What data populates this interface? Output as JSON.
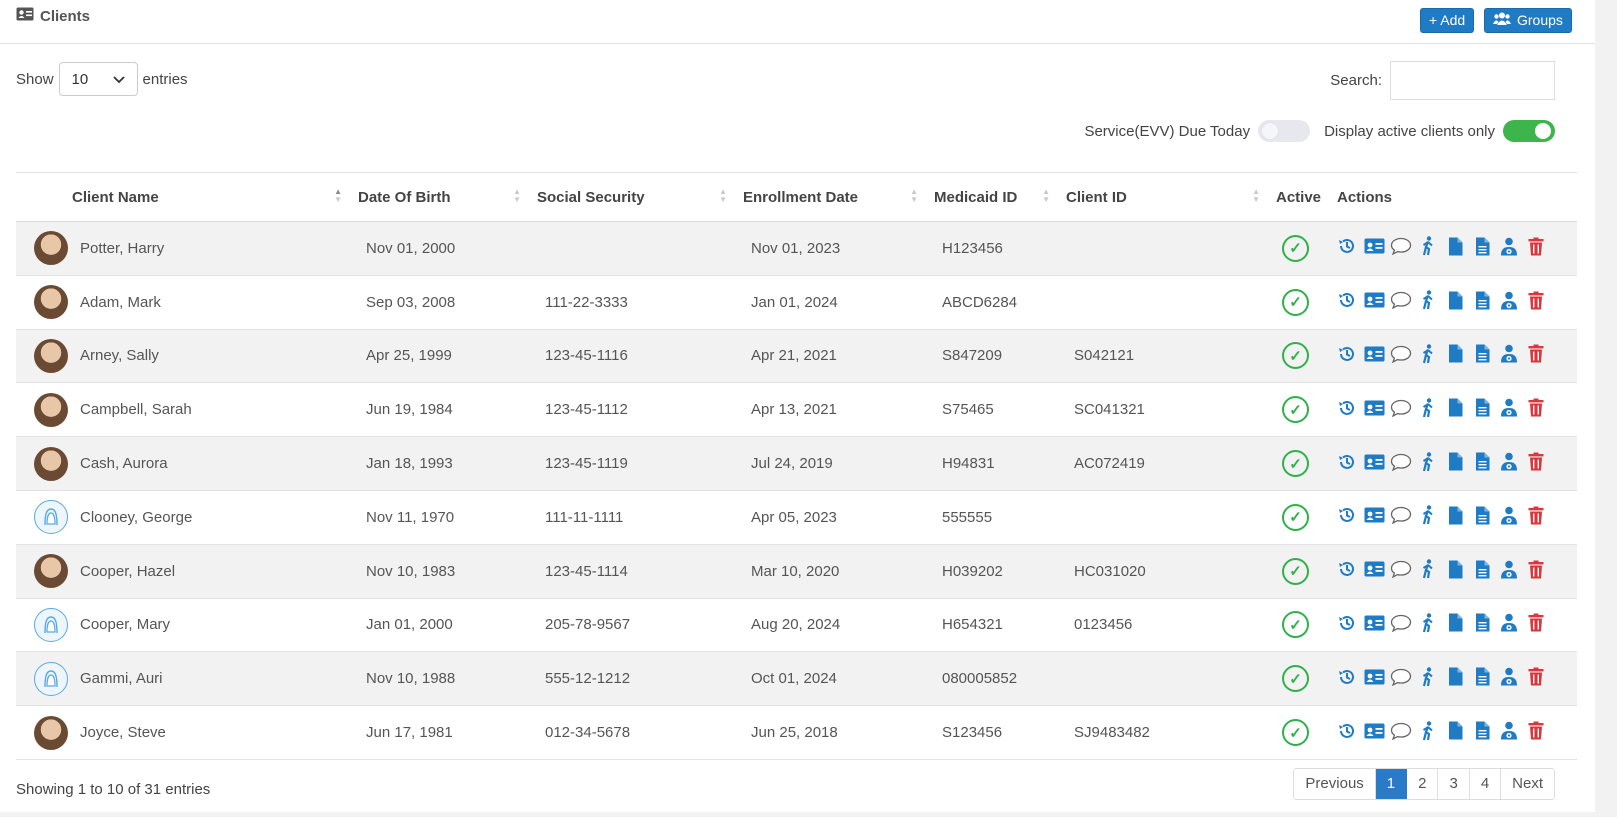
{
  "header": {
    "title": "Clients",
    "add_label": "+ Add",
    "groups_label": "Groups"
  },
  "length": {
    "show_label": "Show",
    "selected": "10",
    "entries_label": "entries"
  },
  "search": {
    "label": "Search:",
    "value": ""
  },
  "toggles": {
    "evv_label": "Service(EVV) Due Today",
    "evv_on": false,
    "active_label": "Display active clients only",
    "active_on": true
  },
  "columns": [
    "Client Name",
    "Date Of Birth",
    "Social Security",
    "Enrollment Date",
    "Medicaid ID",
    "Client ID",
    "Active",
    "Actions"
  ],
  "rows": [
    {
      "name": "Potter, Harry",
      "avatar": "photo",
      "dob": "Nov 01, 2000",
      "ssn": "",
      "enrolled": "Nov 01, 2023",
      "medicaid": "H123456",
      "client_id": "",
      "active": true
    },
    {
      "name": "Adam, Mark",
      "avatar": "photo",
      "dob": "Sep 03, 2008",
      "ssn": "111-22-3333",
      "enrolled": "Jan 01, 2024",
      "medicaid": "ABCD6284",
      "client_id": "",
      "active": true
    },
    {
      "name": "Arney, Sally",
      "avatar": "photo",
      "dob": "Apr 25, 1999",
      "ssn": "123-45-1116",
      "enrolled": "Apr 21, 2021",
      "medicaid": "S847209",
      "client_id": "S042121",
      "active": true
    },
    {
      "name": "Campbell, Sarah",
      "avatar": "photo",
      "dob": "Jun 19, 1984",
      "ssn": "123-45-1112",
      "enrolled": "Apr 13, 2021",
      "medicaid": "S75465",
      "client_id": "SC041321",
      "active": true
    },
    {
      "name": "Cash, Aurora",
      "avatar": "photo",
      "dob": "Jan 18, 1993",
      "ssn": "123-45-1119",
      "enrolled": "Jul 24, 2019",
      "medicaid": "H94831",
      "client_id": "AC072419",
      "active": true
    },
    {
      "name": "Clooney, George",
      "avatar": "placeholder",
      "dob": "Nov 11, 1970",
      "ssn": "111-11-1111",
      "enrolled": "Apr 05, 2023",
      "medicaid": "555555",
      "client_id": "",
      "active": true
    },
    {
      "name": "Cooper, Hazel",
      "avatar": "photo",
      "dob": "Nov 10, 1983",
      "ssn": "123-45-1114",
      "enrolled": "Mar 10, 2020",
      "medicaid": "H039202",
      "client_id": "HC031020",
      "active": true
    },
    {
      "name": "Cooper, Mary",
      "avatar": "placeholder",
      "dob": "Jan 01, 2000",
      "ssn": "205-78-9567",
      "enrolled": "Aug 20, 2024",
      "medicaid": "H654321",
      "client_id": "0123456",
      "active": true
    },
    {
      "name": "Gammi, Auri",
      "avatar": "placeholder",
      "dob": "Nov 10, 1988",
      "ssn": "555-12-1212",
      "enrolled": "Oct 01, 2024",
      "medicaid": "080005852",
      "client_id": "",
      "active": true
    },
    {
      "name": "Joyce, Steve",
      "avatar": "photo",
      "dob": "Jun 17, 1981",
      "ssn": "012-34-5678",
      "enrolled": "Jun 25, 2018",
      "medicaid": "S123456",
      "client_id": "SJ9483482",
      "active": true
    }
  ],
  "actions": [
    "history-icon",
    "id-card-icon",
    "comment-icon",
    "walking-icon",
    "file-icon",
    "file-text-icon",
    "user-group-icon",
    "trash-icon"
  ],
  "footer": {
    "info": "Showing 1 to 10 of 31 entries",
    "previous": "Previous",
    "pages": [
      "1",
      "2",
      "3",
      "4"
    ],
    "current_page": "1",
    "next": "Next"
  },
  "colors": {
    "accent": "#1f7bc4",
    "success": "#2fb14a",
    "danger": "#d9363e"
  }
}
